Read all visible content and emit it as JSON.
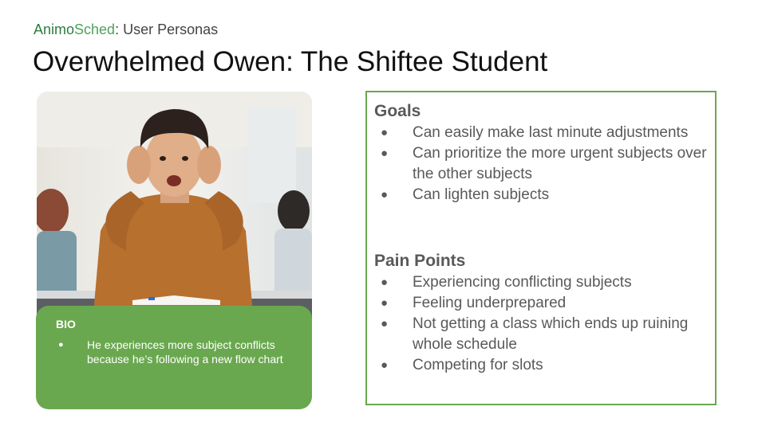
{
  "header": {
    "brand_part1": "Animo",
    "brand_part2": "Sched",
    "brand_suffix": ": User Personas",
    "title": "Overwhelmed Owen: The Shiftee Student"
  },
  "photo": {
    "subject": "stressed student holding head at a desk in a classroom"
  },
  "bio": {
    "title": "BIO",
    "items": [
      "He experiences more subject conflicts because he’s following a new flow chart"
    ]
  },
  "goals": {
    "title": "Goals",
    "items": [
      "Can easily make last minute adjustments",
      "Can prioritize the more urgent subjects over the other subjects",
      "Can lighten subjects"
    ]
  },
  "pain_points": {
    "title": "Pain Points",
    "items": [
      "Experiencing conflicting subjects",
      "Feeling underprepared",
      "Not getting a class which ends up ruining whole schedule",
      "Competing for slots"
    ]
  },
  "bullet": "●",
  "colors": {
    "accent": "#6aa84f",
    "brand_dark": "#2f7a3e",
    "brand_light": "#4fa25a",
    "text_gray": "#595959"
  }
}
